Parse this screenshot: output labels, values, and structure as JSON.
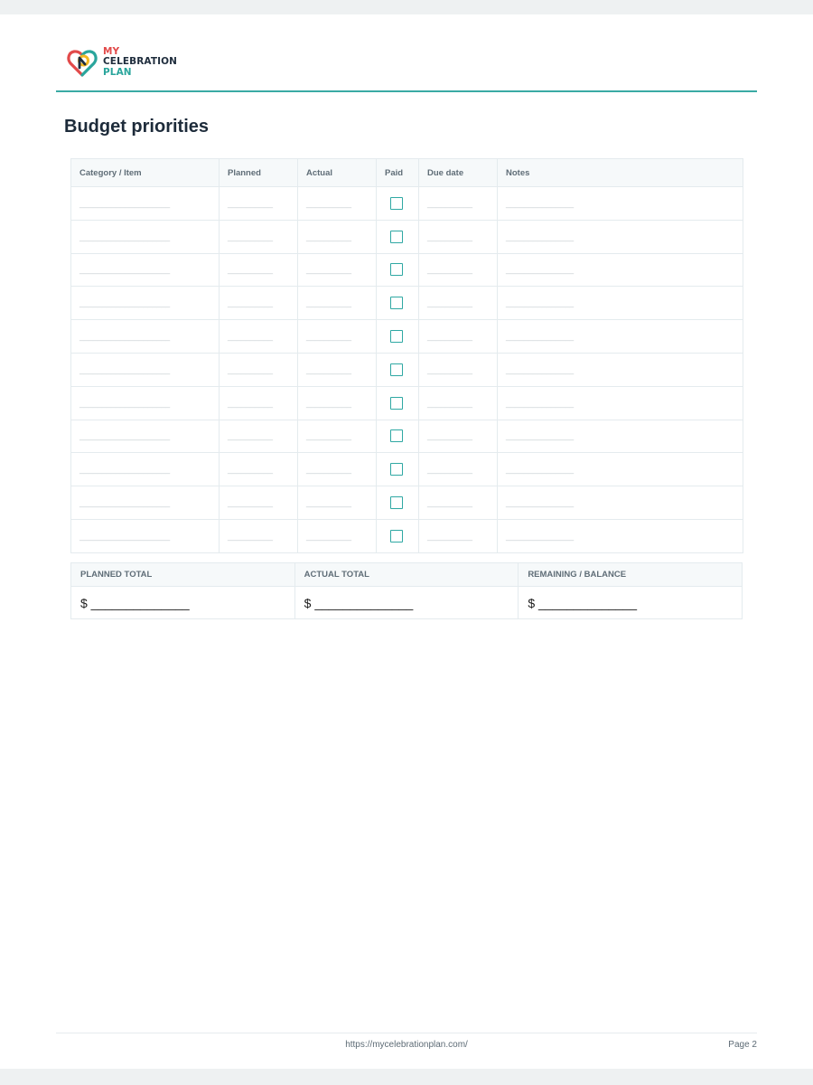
{
  "brand": {
    "line1": "MY",
    "line2": "CELEBRATION",
    "line3": "PLAN",
    "colors": {
      "red": "#e24a4a",
      "navy": "#1f2d3d",
      "teal": "#2aa59c",
      "yellow": "#f5b820"
    }
  },
  "accent_color": "#3aaaa4",
  "section": {
    "title": "Budget priorities"
  },
  "budget_table": {
    "columns": [
      "Category / Item",
      "Planned",
      "Actual",
      "Paid",
      "Due date",
      "Notes"
    ],
    "blanks": {
      "category": "____________________",
      "planned": "__________",
      "actual": "__________",
      "due_date": "__________",
      "notes": "_______________"
    },
    "row_count": 11
  },
  "totals": {
    "labels": [
      "PLANNED TOTAL",
      "ACTUAL TOTAL",
      "REMAINING / BALANCE"
    ],
    "value": "$ ______________"
  },
  "footer": {
    "url": "https://mycelebrationplan.com/",
    "page": "Page 2"
  }
}
